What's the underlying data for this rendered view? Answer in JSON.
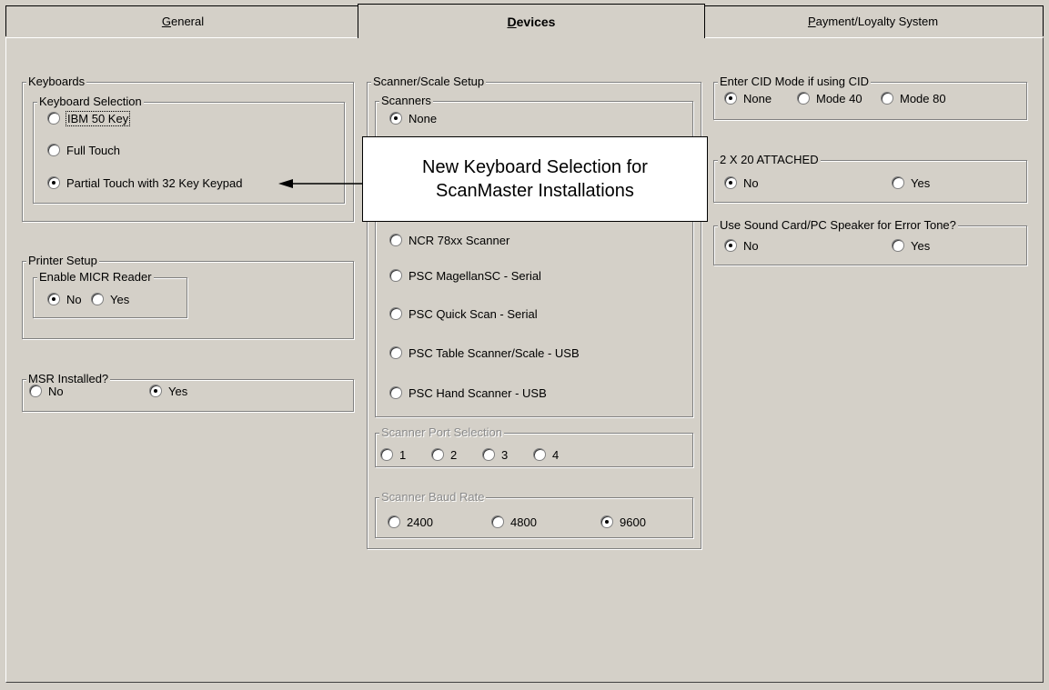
{
  "tabs": [
    {
      "label": "General",
      "hotkey": "G",
      "rest": "eneral"
    },
    {
      "label": "Devices",
      "hotkey": "D",
      "rest": "evices"
    },
    {
      "label": "Payment/Loyalty System",
      "hotkey": "P",
      "rest": "ayment/Loyalty System"
    }
  ],
  "active_tab": "Devices",
  "keyboards": {
    "title": "Keyboards",
    "selection_title": "Keyboard Selection",
    "options": [
      {
        "label": "IBM 50 Key",
        "checked": false
      },
      {
        "label": "Full Touch",
        "checked": false
      },
      {
        "label": "Partial Touch with 32 Key Keypad",
        "checked": true
      }
    ]
  },
  "printer": {
    "title": "Printer Setup",
    "micr_title": "Enable MICR Reader",
    "options": [
      {
        "label": "No",
        "checked": true
      },
      {
        "label": "Yes",
        "checked": false
      }
    ]
  },
  "msr": {
    "title": "MSR Installed?",
    "options": [
      {
        "label": "No",
        "checked": false
      },
      {
        "label": "Yes",
        "checked": true
      }
    ]
  },
  "scanner": {
    "title": "Scanner/Scale Setup",
    "scanners_title": "Scanners",
    "options": [
      {
        "label": "None",
        "checked": true
      },
      {
        "label": "NCR 78xx Scanner",
        "checked": false
      },
      {
        "label": "PSC MagellanSC - Serial",
        "checked": false
      },
      {
        "label": "PSC Quick Scan - Serial",
        "checked": false
      },
      {
        "label": "PSC Table Scanner/Scale - USB",
        "checked": false
      },
      {
        "label": "PSC Hand Scanner - USB",
        "checked": false
      }
    ],
    "port_title": "Scanner Port Selection",
    "ports": [
      {
        "label": "1",
        "checked": false
      },
      {
        "label": "2",
        "checked": false
      },
      {
        "label": "3",
        "checked": false
      },
      {
        "label": "4",
        "checked": false
      }
    ],
    "baud_title": "Scanner Baud Rate",
    "bauds": [
      {
        "label": "2400",
        "checked": false
      },
      {
        "label": "4800",
        "checked": false
      },
      {
        "label": "9600",
        "checked": true
      }
    ]
  },
  "cid": {
    "title": "Enter CID Mode if using CID",
    "options": [
      {
        "label": "None",
        "checked": true
      },
      {
        "label": "Mode 40",
        "checked": false
      },
      {
        "label": "Mode 80",
        "checked": false
      }
    ]
  },
  "display": {
    "title": "2 X 20 ATTACHED",
    "options": [
      {
        "label": "No",
        "checked": true
      },
      {
        "label": "Yes",
        "checked": false
      }
    ]
  },
  "sound": {
    "title": "Use Sound Card/PC Speaker for Error Tone?",
    "options": [
      {
        "label": "No",
        "checked": true
      },
      {
        "label": "Yes",
        "checked": false
      }
    ]
  },
  "callout": {
    "line1": "New Keyboard Selection for",
    "line2": "ScanMaster Installations"
  }
}
